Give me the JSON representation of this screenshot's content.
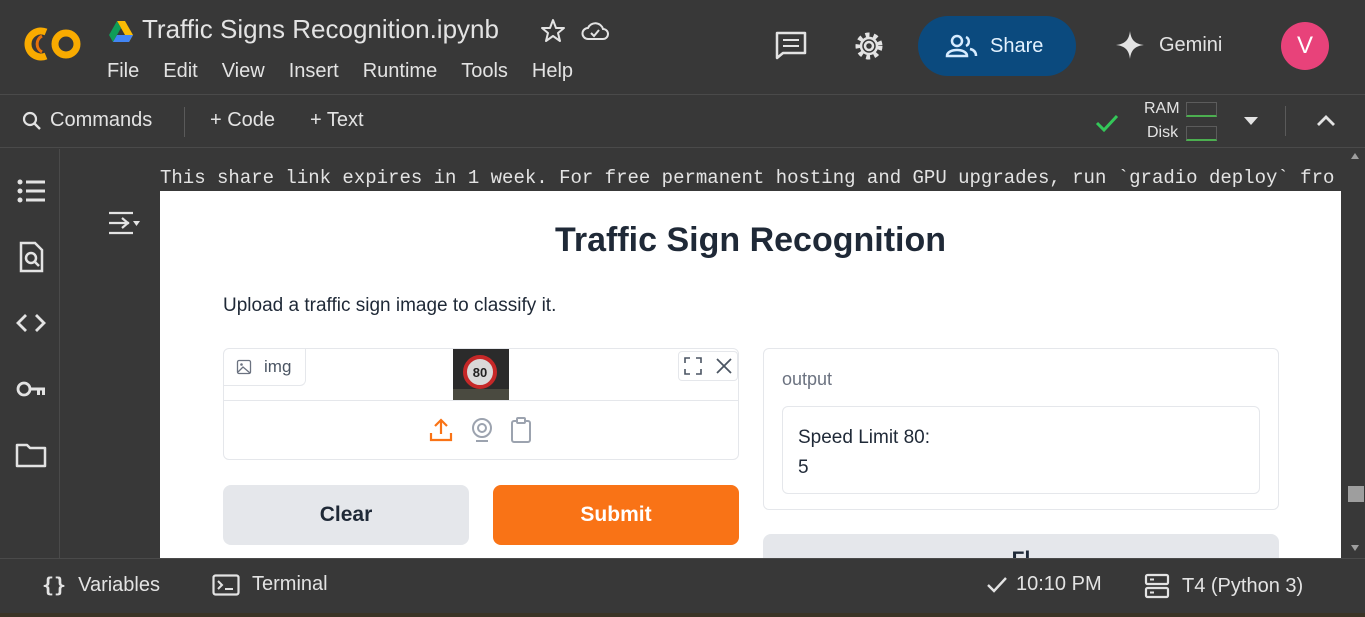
{
  "header": {
    "doc_title": "Traffic Signs Recognition.ipynb",
    "menu": [
      "File",
      "Edit",
      "View",
      "Insert",
      "Runtime",
      "Tools",
      "Help"
    ],
    "share_label": "Share",
    "gemini_label": "Gemini",
    "avatar_initial": "V",
    "avatar_color": "#e8427a",
    "icons": [
      "colab-logo",
      "drive-icon",
      "star-icon",
      "cloud-saved-icon",
      "comment-icon",
      "settings-icon",
      "people-icon",
      "gemini-sparkle-icon"
    ]
  },
  "toolbar": {
    "commands_label": "Commands",
    "code_label": "+ Code",
    "text_label": "+ Text",
    "ram_label": "RAM",
    "disk_label": "Disk"
  },
  "sidebar": {
    "icons": [
      "table-of-contents-icon",
      "find-replace-icon",
      "code-snippets-icon",
      "secrets-key-icon",
      "files-folder-icon"
    ]
  },
  "cell_output": {
    "share_text": "This share link expires in 1 week. For free permanent hosting and GPU upgrades, run `gradio deploy` fro",
    "gradio": {
      "title": "Traffic Sign Recognition",
      "description": "Upload a traffic sign image to classify it.",
      "image_input_label": "img",
      "thumbnail_sign_text": "80",
      "output_label": "output",
      "output_line1": "Speed Limit 80:",
      "output_line2": "5",
      "clear_label": "Clear",
      "submit_label": "Submit",
      "flag_label": "Fl",
      "accent_color": "#f97316"
    }
  },
  "statusbar": {
    "variables_label": "Variables",
    "terminal_label": "Terminal",
    "time": "10:10 PM",
    "runtime": "T4 (Python 3)"
  }
}
